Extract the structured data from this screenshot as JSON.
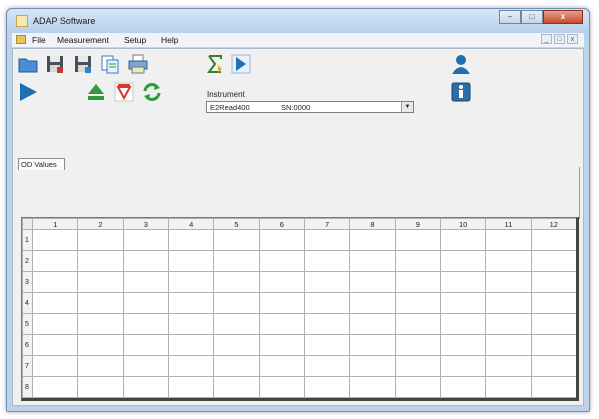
{
  "window": {
    "title": "ADAP Software"
  },
  "menu": [
    "File",
    "Measurement",
    "Setup",
    "Help"
  ],
  "mdi_buttons": [
    "_",
    "□",
    "x"
  ],
  "title_buttons": [
    "–",
    "□",
    "x"
  ],
  "toolbar": {
    "icons": [
      "open-folder-icon",
      "save-icon",
      "save-as-icon",
      "copy-icon",
      "print-icon",
      "sum-icon",
      "export-icon",
      "user-icon",
      "play-icon",
      "eject-icon",
      "filter-icon",
      "refresh-icon",
      "info-icon"
    ]
  },
  "instrument": {
    "label": "Instrument",
    "model": "E2Read400",
    "serial": "SN:0000",
    "dropdown": "▼"
  },
  "tab": {
    "label": "OD Values"
  },
  "grid": {
    "columns": [
      "1",
      "2",
      "3",
      "4",
      "5",
      "6",
      "7",
      "8",
      "9",
      "10",
      "11",
      "12"
    ],
    "rows": [
      "1",
      "2",
      "3",
      "4",
      "5",
      "6",
      "7",
      "8"
    ]
  },
  "colors": {
    "accent_blue": "#1f6fb5",
    "green": "#2e9a3a",
    "red": "#d0392b",
    "title_bar": "#bcd3ea"
  }
}
